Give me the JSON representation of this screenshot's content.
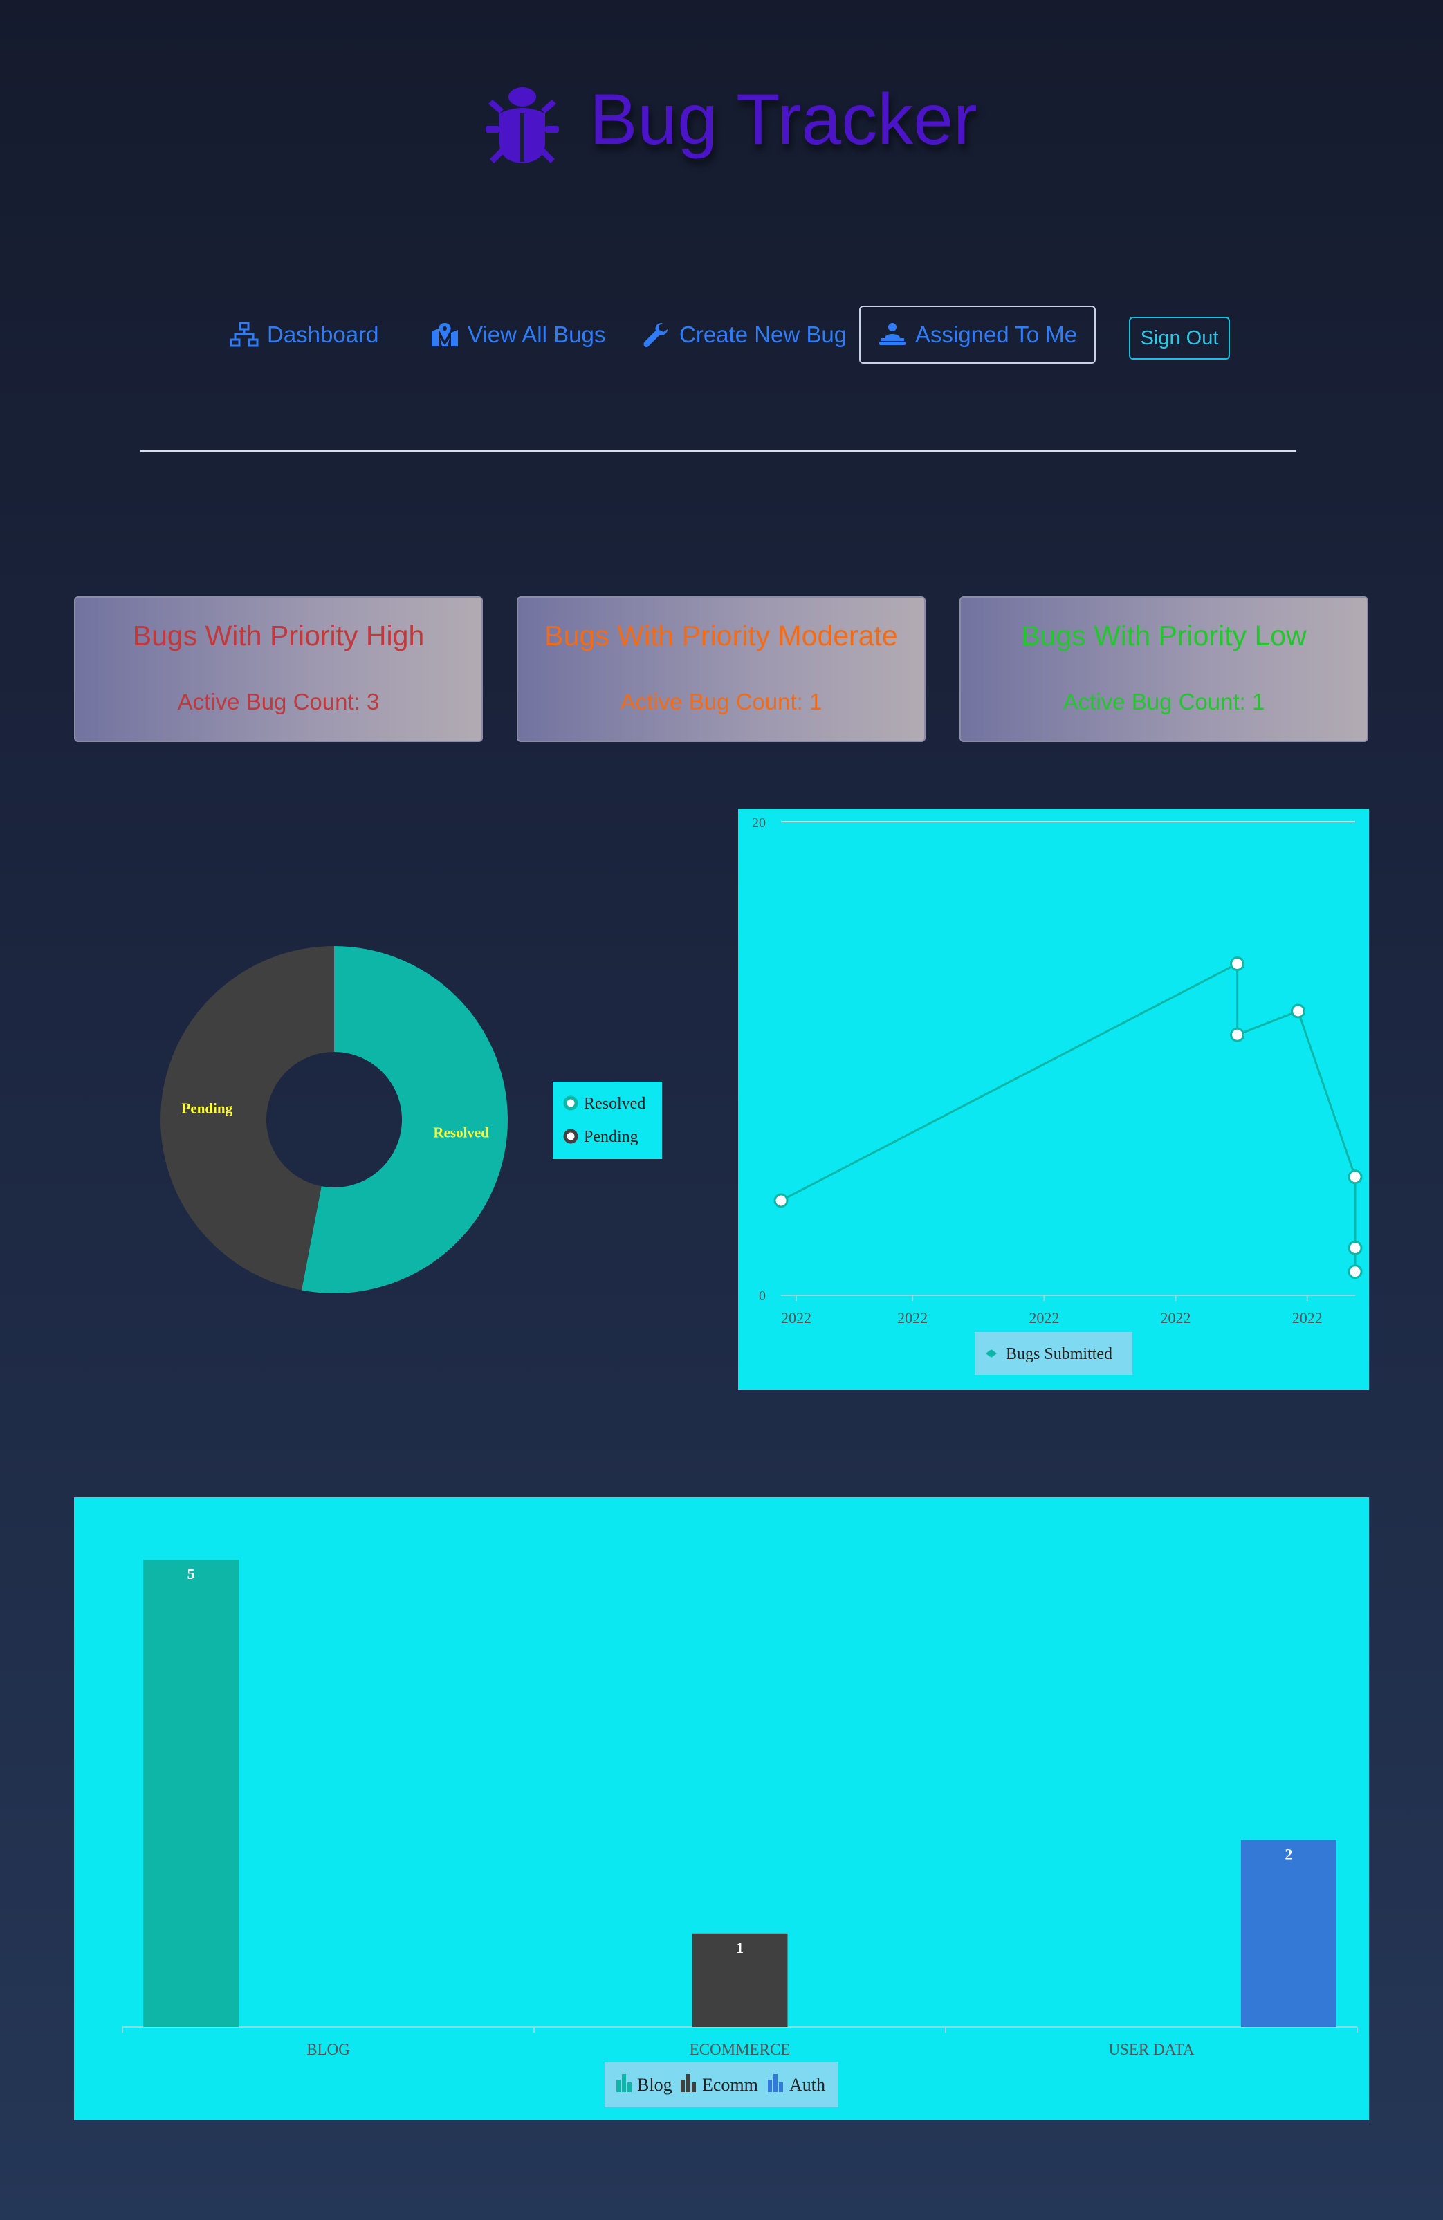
{
  "header": {
    "title": "Bug Tracker",
    "logo_icon": "bug-icon",
    "title_color": "#4b14c7"
  },
  "nav": {
    "items": [
      {
        "label": "Dashboard",
        "icon": "sitemap-icon"
      },
      {
        "label": "View All Bugs",
        "icon": "map-marked-icon"
      },
      {
        "label": "Create New Bug",
        "icon": "wrench-icon"
      },
      {
        "label": "Assigned To Me",
        "icon": "user-laptop-icon",
        "active": true
      }
    ],
    "sign_out": "Sign Out",
    "link_color": "#2f7cf6"
  },
  "priority_cards": [
    {
      "title": "Bugs With Priority High",
      "count_text": "Active Bug Count: 3",
      "color": "#c0393d"
    },
    {
      "title": "Bugs With Priority Moderate",
      "count_text": "Active Bug Count: 1",
      "color": "#f26b17"
    },
    {
      "title": "Bugs With Priority Low",
      "count_text": "Active Bug Count: 1",
      "color": "#24c62d"
    }
  ],
  "chart_data": [
    {
      "type": "pie",
      "donut": true,
      "labels": [
        "Resolved",
        "Pending"
      ],
      "values": [
        53,
        47
      ],
      "colors": [
        "#0db6a6",
        "#404040"
      ],
      "slice_label_color": "#ffff33",
      "legend": [
        "Resolved",
        "Pending"
      ],
      "legend_position": "right"
    },
    {
      "type": "line",
      "series": [
        {
          "name": "Bugs Submitted",
          "color": "#0db6a6"
        }
      ],
      "points": [
        {
          "x": 0.0,
          "y": 4
        },
        {
          "x": 0.6,
          "y": 14
        },
        {
          "x": 0.6,
          "y": 11
        },
        {
          "x": 0.68,
          "y": 12
        },
        {
          "x": 0.755,
          "y": 5
        },
        {
          "x": 0.755,
          "y": 2
        },
        {
          "x": 0.755,
          "y": 1
        }
      ],
      "xlim": [
        0,
        0.755
      ],
      "x_tick_labels": [
        "2022",
        "2022",
        "2022",
        "2022",
        "2022"
      ],
      "x_tick_values": [
        0.02,
        0.173,
        0.346,
        0.519,
        0.692
      ],
      "y_tick_labels": [
        "0",
        "20"
      ],
      "ylim": [
        0,
        20
      ],
      "legend_position": "bottom"
    },
    {
      "type": "bar",
      "categories": [
        "BLOG",
        "ECOMMERCE",
        "USER DATA"
      ],
      "series": [
        {
          "name": "Blog",
          "values": [
            5,
            null,
            null
          ],
          "color": "#0db6a6"
        },
        {
          "name": "Ecomm",
          "values": [
            null,
            1,
            null
          ],
          "color": "#404040"
        },
        {
          "name": "Auth",
          "values": [
            null,
            null,
            2
          ],
          "color": "#3579d6"
        }
      ],
      "ylim": [
        0,
        5
      ],
      "legend_position": "bottom"
    }
  ]
}
